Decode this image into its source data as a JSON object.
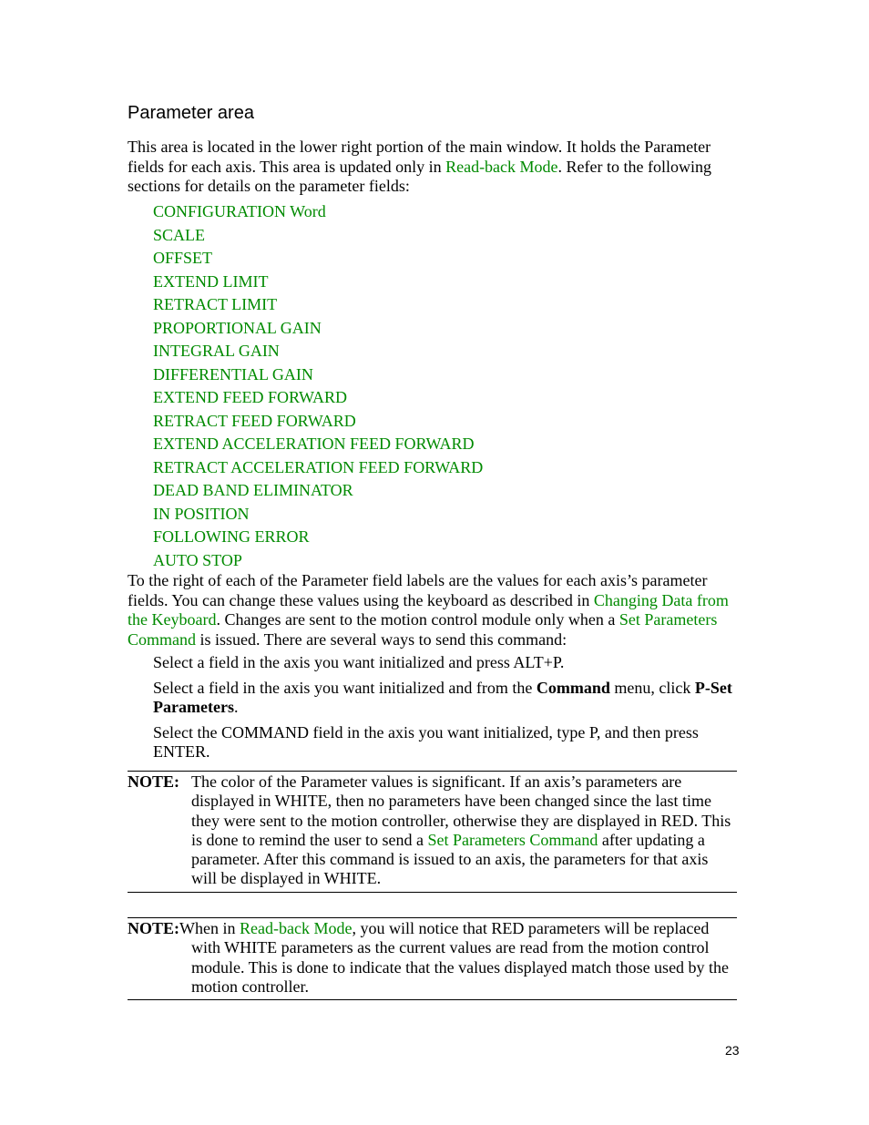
{
  "heading": "Parameter area",
  "intro": {
    "text_before_link": "This area is located in the lower right portion of the main window.  It holds the Parameter fields for each axis.  This area is updated only in ",
    "link": "Read-back Mode",
    "text_after_link": ".  Refer to the following sections for details on the parameter fields:"
  },
  "parameter_links": [
    "CONFIGURATION Word",
    "SCALE",
    "OFFSET",
    "EXTEND LIMIT",
    "RETRACT LIMIT",
    "PROPORTIONAL GAIN",
    "INTEGRAL GAIN",
    "DIFFERENTIAL GAIN",
    "EXTEND FEED FORWARD",
    "RETRACT FEED FORWARD",
    "EXTEND ACCELERATION FEED FORWARD",
    "RETRACT ACCELERATION FEED FORWARD",
    "DEAD BAND ELIMINATOR",
    "IN POSITION",
    "FOLLOWING ERROR",
    "AUTO STOP"
  ],
  "values_para": {
    "text1": "To the right of each of the Parameter field labels are the values for each axis’s parameter fields.  You can change these values using the keyboard as described in ",
    "link1": "Changing Data from the Keyboard",
    "text2": ".  Changes are sent to the motion control module only when a ",
    "link2": "Set Parameters Command",
    "text3": " is issued.  There are several ways to send this command:"
  },
  "steps": {
    "step1": "Select a field in the axis you want initialized and press ALT+P.",
    "step2_before": "Select a field in the axis you want initialized and from the ",
    "step2_bold1": "Command",
    "step2_middle": " menu, click ",
    "step2_bold2": "P-Set Parameters",
    "step2_after": ".",
    "step3": "Select the COMMAND field in the axis you want initialized, type P, and then press ENTER."
  },
  "note1": {
    "label": "NOTE:",
    "text1": "The color of the Parameter values is significant.  If an axis’s parameters are displayed in WHITE, then no parameters have been changed since the last time they were sent to the motion controller, otherwise they are displayed in RED.  This is done to remind the user to send a ",
    "link": "Set Parameters Command",
    "text2": " after updating a parameter.  After this command is issued to an axis, the parameters for that axis will be displayed in WHITE."
  },
  "note2": {
    "label": "NOTE:",
    "text1": "When in ",
    "link": "Read-back Mode",
    "text2": ", you will notice that RED parameters will be replaced with WHITE parameters as the current values are read from the motion control module.  This is done to indicate that the values displayed match those used by the motion controller."
  },
  "page_number": "23",
  "colors": {
    "link": "#008a00",
    "text": "#000000"
  }
}
